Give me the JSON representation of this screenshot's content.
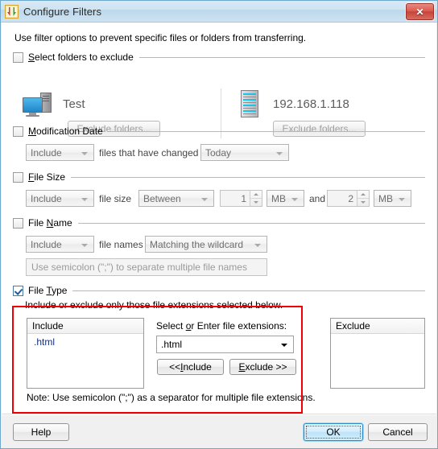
{
  "window": {
    "title": "Configure Filters",
    "app_icon": "transfer-filter-icon",
    "close_label": "✕"
  },
  "intro": "Use filter options to prevent specific files or folders from transferring.",
  "sections": {
    "folders": {
      "checkbox_checked": false,
      "label_pre": "",
      "label_accel": "S",
      "label_post": "elect folders to exclude",
      "left_endpoint": {
        "icon": "computer-icon",
        "name": "Test",
        "button_label": "Exclude folders..."
      },
      "right_endpoint": {
        "icon": "server-icon",
        "name": "192.168.1.118",
        "button_label": "Exclude folders..."
      }
    },
    "modification_date": {
      "checkbox_checked": false,
      "label_accel": "M",
      "label_post": "odification Date",
      "mode_value": "Include",
      "middle_text": "files that have changed",
      "when_value": "Today"
    },
    "file_size": {
      "checkbox_checked": false,
      "label_pre": "",
      "label_accel": "F",
      "label_post": "ile Size",
      "mode_value": "Include",
      "middle_text": "file size",
      "comparison_value": "Between",
      "min_value": "1",
      "min_unit": "MB",
      "conjunction": "and",
      "max_value": "2",
      "max_unit": "MB"
    },
    "file_name": {
      "checkbox_checked": false,
      "label_pre": "File ",
      "label_accel": "N",
      "label_post": "ame",
      "mode_value": "Include",
      "middle_text": "file names",
      "match_value": "Matching the wildcard",
      "names_placeholder": "Use semicolon (\";\") to separate multiple file names"
    },
    "file_type": {
      "checkbox_checked": true,
      "label_pre": "File ",
      "label_accel": "T",
      "label_post": "ype",
      "description": "Include or exclude only those file extensions selected below.",
      "include_list": {
        "header": "Include",
        "items": [
          ".html"
        ]
      },
      "exclude_list": {
        "header": "Exclude",
        "items": []
      },
      "extensions_label_pre": "Select ",
      "extensions_label_accel": "o",
      "extensions_label_post": "r Enter file extensions:",
      "extensions_value": ".html",
      "include_button_pre": "<< ",
      "include_button_accel": "I",
      "include_button_post": "nclude",
      "exclude_button_accel": "E",
      "exclude_button_post": "xclude >>",
      "note": "Note: Use semicolon (\";\") as a separator for multiple file extensions.",
      "highlight_color": "#f00000"
    }
  },
  "footer": {
    "help_label": "Help",
    "ok_label": "OK",
    "cancel_label": "Cancel"
  }
}
